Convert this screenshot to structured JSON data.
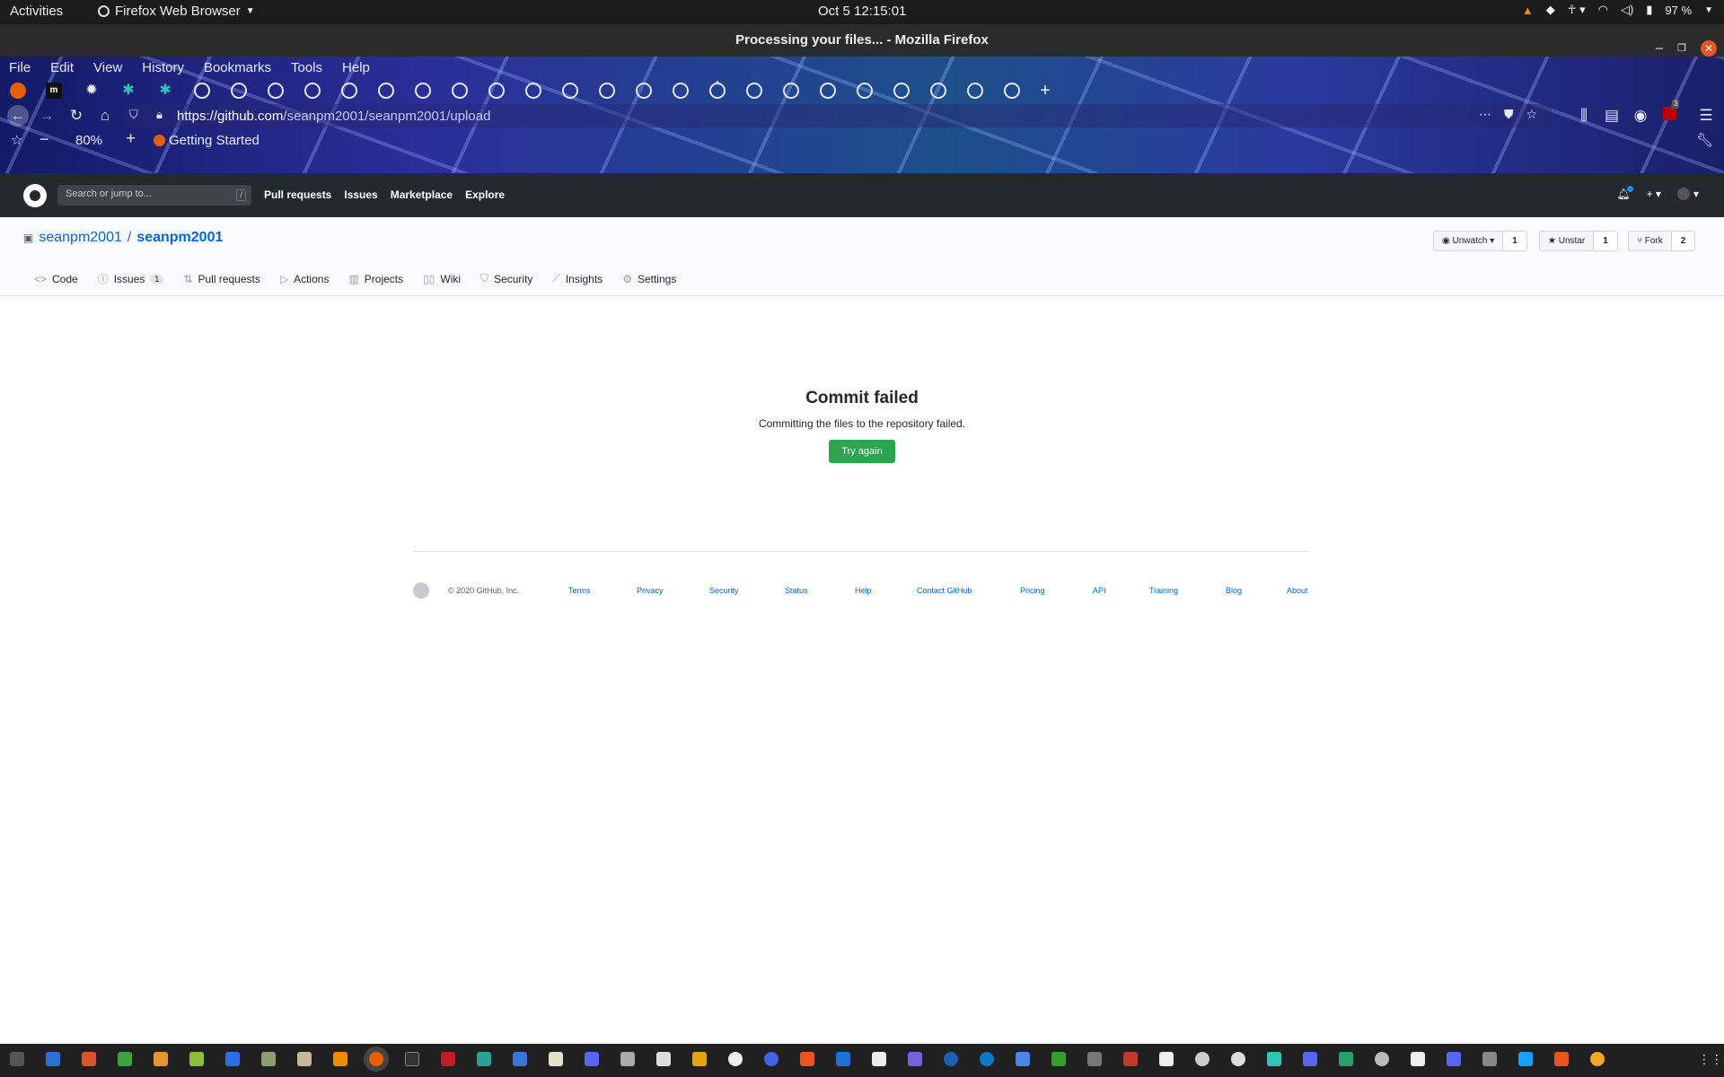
{
  "os_topbar": {
    "activities": "Activities",
    "app_menu": "Firefox Web Browser",
    "clock": "Oct 5  12:15:01",
    "battery": "97 %"
  },
  "window": {
    "title": "Processing your files... - Mozilla Firefox"
  },
  "firefox": {
    "menu": [
      "File",
      "Edit",
      "View",
      "History",
      "Bookmarks",
      "Tools",
      "Help"
    ],
    "url_host": "https://github.com",
    "url_path": "/seanpm2001/seanpm2001/upload",
    "zoom": "80%",
    "bookmark_label": "Getting Started",
    "ublock_badge": "3"
  },
  "github_header": {
    "search_placeholder": "Search or jump to...",
    "search_shortcut": "/",
    "nav": [
      "Pull requests",
      "Issues",
      "Marketplace",
      "Explore"
    ]
  },
  "repo": {
    "owner": "seanpm2001",
    "separator": "/",
    "name": "seanpm2001",
    "watch_label": "Unwatch",
    "watch_count": "1",
    "star_label": "Unstar",
    "star_count": "1",
    "fork_label": "Fork",
    "fork_count": "2",
    "tabs": [
      {
        "label": "Code",
        "icon": "code-icon"
      },
      {
        "label": "Issues",
        "icon": "issue-icon",
        "counter": "1"
      },
      {
        "label": "Pull requests",
        "icon": "pull-request-icon"
      },
      {
        "label": "Actions",
        "icon": "play-icon"
      },
      {
        "label": "Projects",
        "icon": "project-icon"
      },
      {
        "label": "Wiki",
        "icon": "book-icon"
      },
      {
        "label": "Security",
        "icon": "shield-icon"
      },
      {
        "label": "Insights",
        "icon": "graph-icon"
      },
      {
        "label": "Settings",
        "icon": "gear-icon"
      }
    ]
  },
  "message": {
    "title": "Commit failed",
    "body": "Committing the files to the repository failed.",
    "button": "Try again"
  },
  "footer": {
    "copyright": "© 2020 GitHub, Inc.",
    "links": [
      "Terms",
      "Privacy",
      "Security",
      "Status",
      "Help",
      "Contact GitHub",
      "Pricing",
      "API",
      "Training",
      "Blog",
      "About"
    ]
  },
  "colors": {
    "github_header": "#24292e",
    "link": "#0366d6",
    "primary_button": "#2ea44f",
    "ubuntu_accent": "#e95420"
  }
}
